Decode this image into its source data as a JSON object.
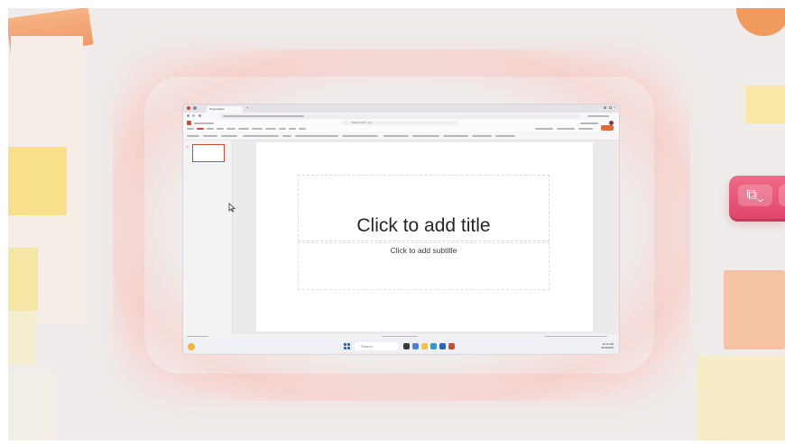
{
  "browser": {
    "tab_label": "Presentation",
    "address": "",
    "search_placeholder": "Search (Alt + Q)"
  },
  "slide_panel": {
    "slide_number": "1"
  },
  "slide": {
    "title_placeholder": "Click to add title",
    "subtitle_placeholder": "Click to add subtitle"
  },
  "taskbar": {
    "search_label": "Search",
    "time": "11:41 AM",
    "date": "5/20/2024"
  },
  "floating_button": {
    "icon": "shapes-icon",
    "chevron": "chevron-down-icon"
  },
  "colors": {
    "accent": "#c94f2c",
    "pink_button": "#e8547a",
    "background": "#efeceb"
  }
}
